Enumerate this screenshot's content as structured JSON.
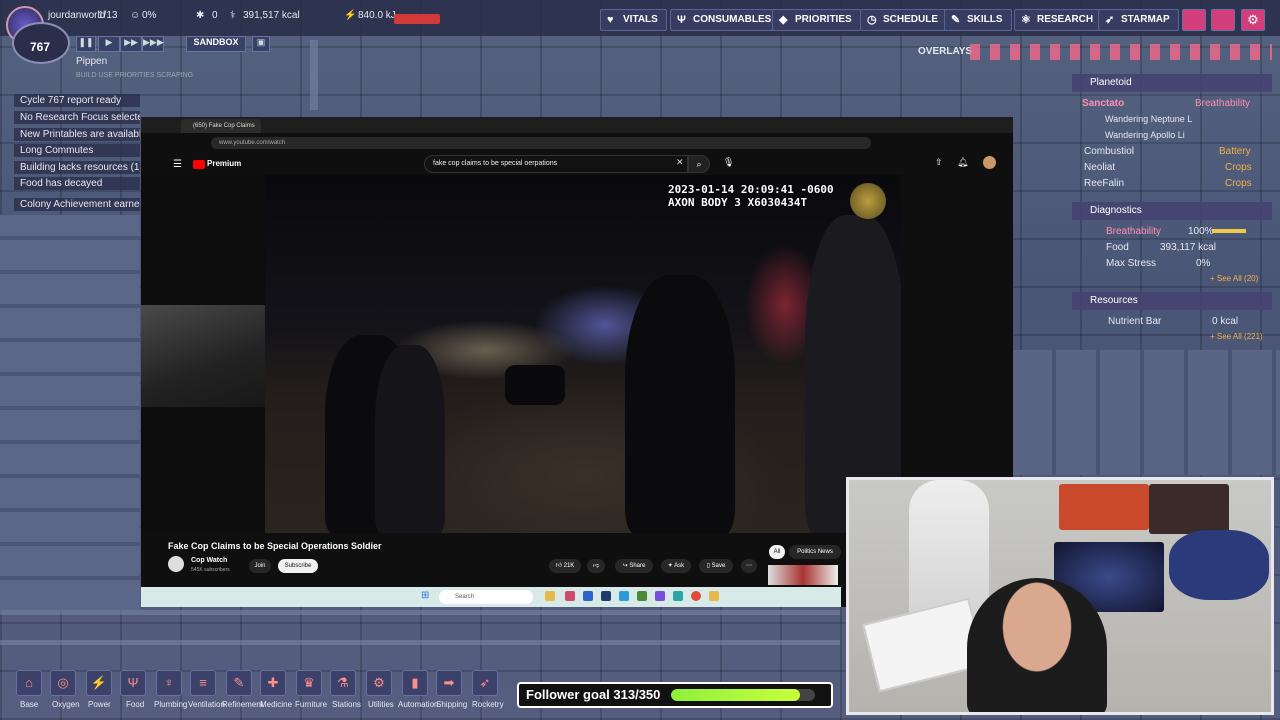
{
  "topbar": {
    "player": "jourdanworld",
    "dupes": "1/13",
    "stress": "0%",
    "sick": "0",
    "calories": "391,517 kcal",
    "power": "840.0 kJ",
    "cycle_num": "767",
    "sandbox_label": "SANDBOX",
    "nav": [
      "VITALS",
      "CONSUMABLES",
      "PRIORITIES",
      "SCHEDULE",
      "SKILLS",
      "RESEARCH",
      "STARMAP"
    ]
  },
  "overlays_label": "OVERLAYS",
  "dupe_name": "Pippen",
  "dupe_sub": "BUILD USE PRIORITIES SCRAPING",
  "notifications": [
    "Cycle 767 report ready",
    "No Research Focus selected",
    "New Printables are available",
    "Long Commutes",
    "Building lacks resources (1)",
    "Food has decayed",
    "Colony Achievement earned"
  ],
  "right_panel": {
    "planetoid_header": "Planetoid",
    "sanctato": "Sanctato",
    "sanctato_status": "Breathability",
    "sub1": "Wandering Neptune L",
    "sub2": "Wandering Apollo Li",
    "combustiol": "Combustiol",
    "combustiol_status": "Battery",
    "neoliat": "Neoliat",
    "neoliat_status": "Crops",
    "reefalin": "ReeFalin",
    "reefalin_status": "Crops",
    "diagnostics_header": "Diagnostics",
    "diag": [
      {
        "name": "Breathability",
        "value": "100%"
      },
      {
        "name": "Food",
        "value": "393,117 kcal"
      },
      {
        "name": "Max Stress",
        "value": "0%"
      }
    ],
    "see_all_diag": "+ See All (20)",
    "resources_header": "Resources",
    "res_name": "Nutrient Bar",
    "res_value": "0 kcal",
    "see_all_res": "+ See All (221)"
  },
  "browser": {
    "tab_title": "(650) Fake Cop Claims",
    "url": "www.youtube.com/watch",
    "brand": "Premium",
    "search_query": "fake cop claims to be special oerpations",
    "timestamp": "2023-01-14 20:09:41 -0600\nAXON BODY 3 X6030434T",
    "video_title": "Fake Cop Claims to be Special Operations Soldier",
    "channel": "Cop Watch",
    "subs": "545K subscribers",
    "join": "Join",
    "subscribe": "Subscribe",
    "likes": "21K",
    "share": "Share",
    "ask": "Ask",
    "save": "Save",
    "chip_all": "All",
    "chip_politics": "Politics News",
    "taskbar_search": "Search"
  },
  "hud": {
    "labels": [
      "Base",
      "Oxygen",
      "Power",
      "Food",
      "Plumbing",
      "Ventilation",
      "Refinement",
      "Medicine",
      "Furniture",
      "Stations",
      "Utilities",
      "Automation",
      "Shipping",
      "Rocketry"
    ]
  },
  "follower": {
    "text": "Follower goal 313/350",
    "progress": 0.894
  }
}
